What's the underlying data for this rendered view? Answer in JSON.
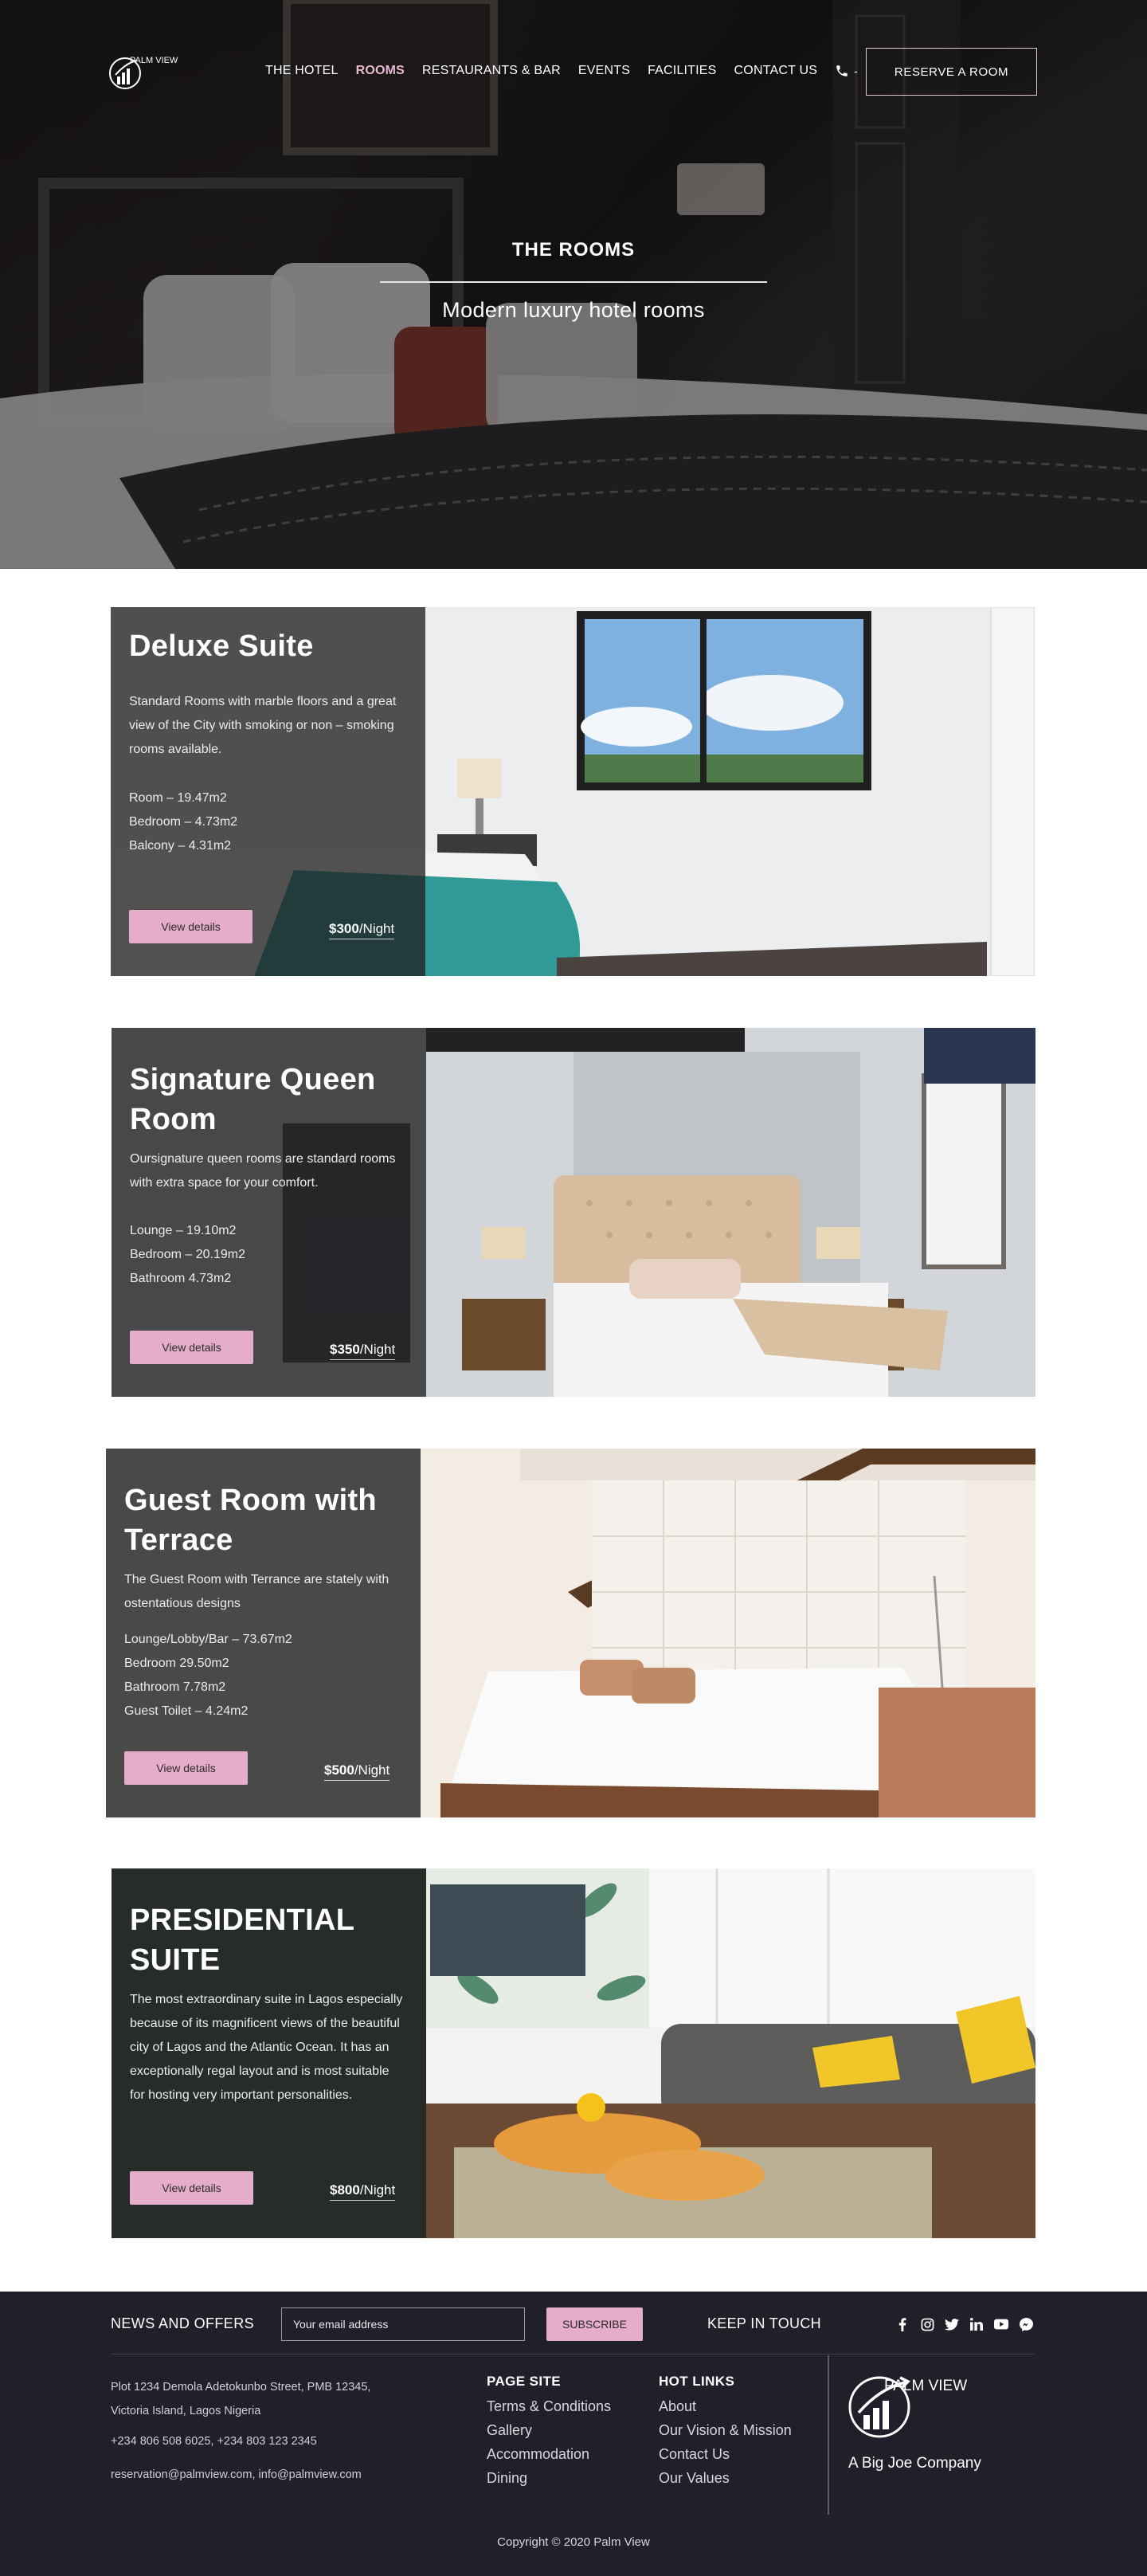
{
  "brand": {
    "logo_text": "PALM VIEW"
  },
  "nav": {
    "items": [
      {
        "label": "THE HOTEL",
        "active": false
      },
      {
        "label": "ROOMS",
        "active": true
      },
      {
        "label": "RESTAURANTS & BAR",
        "active": false
      },
      {
        "label": "EVENTS",
        "active": false
      },
      {
        "label": "FACILITIES",
        "active": false
      },
      {
        "label": "CONTACT US",
        "active": false
      }
    ],
    "phone_icon": "phone-icon",
    "phone_suffix": "-",
    "reserve_label": "RESERVE A ROOM"
  },
  "hero": {
    "title": "THE ROOMS",
    "subtitle": "Modern luxury hotel rooms"
  },
  "rooms": [
    {
      "title": "Deluxe Suite",
      "description": "Standard Rooms with marble floors and a great view of the City with smoking or non – smoking rooms available.",
      "specs": [
        "Room – 19.47m2",
        "Bedroom – 4.73m2",
        "Balcony – 4.31m2"
      ],
      "button": "View details",
      "price": "$300",
      "price_unit": "/Night"
    },
    {
      "title": "Signature Queen Room",
      "description": "Oursignature queen rooms are standard rooms with extra space for your comfort.",
      "specs": [
        "Lounge – 19.10m2",
        "Bedroom – 20.19m2",
        "Bathroom 4.73m2"
      ],
      "button": "View details",
      "price": "$350",
      "price_unit": "/Night"
    },
    {
      "title": "Guest Room with Terrace",
      "description": "The Guest Room with Terrance are stately with ostentatious designs",
      "specs": [
        "Lounge/Lobby/Bar – 73.67m2",
        "Bedroom 29.50m2",
        "Bathroom 7.78m2",
        "Guest Toilet – 4.24m2"
      ],
      "button": "View details",
      "price": "$500",
      "price_unit": "/Night"
    },
    {
      "title": "PRESIDENTIAL SUITE",
      "description": "The most extraordinary suite in Lagos especially because of its magnificent views of the beautiful city of Lagos and the Atlantic Ocean. It has an exceptionally regal layout and is most suitable for hosting very important personalities.",
      "specs": [],
      "button": "View details",
      "price": "$800",
      "price_unit": "/Night"
    }
  ],
  "footer": {
    "news_label": "NEWS AND OFFERS",
    "email_placeholder": "Your email address",
    "subscribe_label": "SUBSCRIBE",
    "keep_in_touch": "KEEP IN TOUCH",
    "social_icons": [
      "facebook-icon",
      "instagram-icon",
      "twitter-icon",
      "linkedin-icon",
      "youtube-icon",
      "messenger-icon"
    ],
    "address_line1": "Plot 1234 Demola Adetokunbo Street, PMB 12345,",
    "address_line2": "Victoria Island, Lagos Nigeria",
    "phones": "+234 806 508 6025, +234 803 123 2345",
    "emails": "reservation@palmview.com, info@palmview.com",
    "page_site": {
      "heading": "PAGE SITE",
      "links": [
        "Terms & Conditions",
        "Gallery",
        "Accommodation",
        "Dining"
      ]
    },
    "hot_links": {
      "heading": "HOT LINKS",
      "links": [
        "About",
        "Our Vision & Mission",
        "Contact Us",
        "Our Values"
      ]
    },
    "logo_text": "PALM VIEW",
    "company": "A Big Joe Company",
    "copyright": "Copyright © 2020 Palm View"
  },
  "colors": {
    "accent_pink": "#e5adc9",
    "nav_active": "#e7b9d3",
    "footer_bg": "#1f2029",
    "card_overlay": "#1e1e20"
  }
}
